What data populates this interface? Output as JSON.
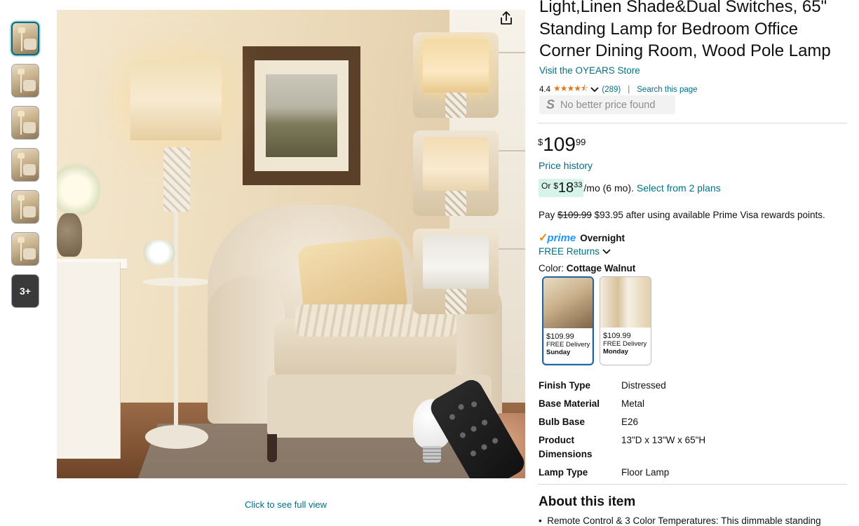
{
  "gallery": {
    "more_label": "3+",
    "full_view_link": "Click to see full view"
  },
  "product": {
    "title": "Light,Linen Shade&Dual Switches, 65\" Standing Lamp for Bedroom Office Corner Dining Room, Wood Pole Lamp",
    "store_link": "Visit the OYEARS Store",
    "rating": "4.4",
    "stars_display": "★★★★⯪",
    "review_count": "(289)",
    "search_link": "Search this page",
    "no_better_price": "No better price found",
    "no_better_price_logo": "S"
  },
  "price": {
    "symbol": "$",
    "whole": "109",
    "fraction": "99",
    "history_link": "Price history"
  },
  "financing": {
    "prefix": "Or",
    "symbol": "$",
    "whole": "18",
    "fraction": "33",
    "suffix": "/mo (6 mo).",
    "plans_link": "Select from 2 plans"
  },
  "rewards": {
    "pay": "Pay",
    "original": "$109.99",
    "after": "$93.95 after using available Prime Visa rewards points."
  },
  "shipping": {
    "prime_check": "✓",
    "prime_word": "prime",
    "prime_speed": "Overnight",
    "returns_link": "FREE Returns"
  },
  "color": {
    "label": "Color:",
    "selected": "Cottage Walnut",
    "options": [
      {
        "price": "$109.99",
        "delivery": "FREE Delivery",
        "day": "Sunday"
      },
      {
        "price": "$109.99",
        "delivery": "FREE Delivery",
        "day": "Monday"
      }
    ]
  },
  "specs": [
    {
      "key": "Finish Type",
      "value": "Distressed"
    },
    {
      "key": "Base Material",
      "value": "Metal"
    },
    {
      "key": "Bulb Base",
      "value": "E26"
    },
    {
      "key": "Product Dimensions",
      "value": "13\"D x 13\"W x 65\"H"
    },
    {
      "key": "Lamp Type",
      "value": "Floor Lamp"
    }
  ],
  "about": {
    "heading": "About this item",
    "first_bullet": "Remote Control & 3 Color Temperatures: This dimmable standing"
  }
}
